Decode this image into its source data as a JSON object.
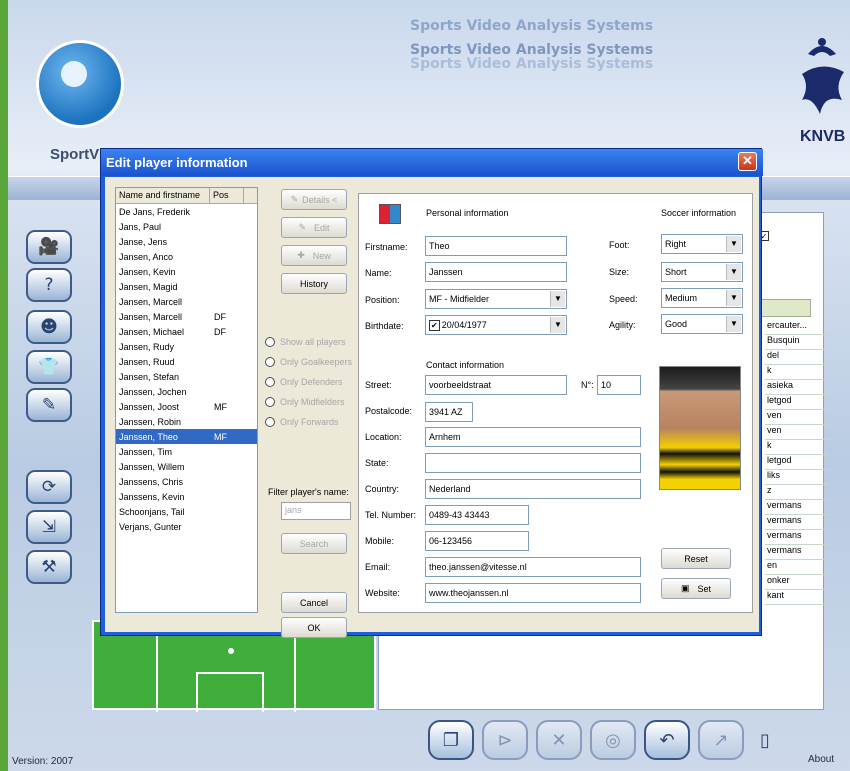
{
  "app": {
    "watermarks": [
      "Sports Video Analysis Systems",
      "Sports Video Analysis Systems",
      "Sports Video Analysis Systems"
    ],
    "brand": "SportV",
    "federation": "KNVB",
    "version": "Version: 2007",
    "about": "About",
    "right_names": [
      "ercauter...",
      "Busquin",
      "del",
      "k",
      "asieka",
      "letgod",
      "ven",
      "ven",
      "k",
      "letgod",
      "liks",
      "z",
      "vermans",
      "vermans",
      "vermans",
      "vermans",
      "en",
      "onker",
      "kant"
    ]
  },
  "dialog": {
    "title": "Edit player information",
    "close": "✕",
    "list_headers": {
      "name": "Name and firstname",
      "pos": "Pos"
    },
    "players": [
      {
        "name": "De Jans, Frederik",
        "pos": ""
      },
      {
        "name": "Jans, Paul",
        "pos": ""
      },
      {
        "name": "Janse, Jens",
        "pos": ""
      },
      {
        "name": "Jansen, Anco",
        "pos": ""
      },
      {
        "name": "Jansen, Kevin",
        "pos": ""
      },
      {
        "name": "Jansen, Magid",
        "pos": ""
      },
      {
        "name": "Jansen, Marcell",
        "pos": ""
      },
      {
        "name": "Jansen, Marcell",
        "pos": "DF"
      },
      {
        "name": "Jansen, Michael",
        "pos": "DF"
      },
      {
        "name": "Jansen, Rudy",
        "pos": ""
      },
      {
        "name": "Jansen, Ruud",
        "pos": ""
      },
      {
        "name": "Jansen, Stefan",
        "pos": ""
      },
      {
        "name": "Janssen, Jochen",
        "pos": ""
      },
      {
        "name": "Janssen, Joost",
        "pos": "MF"
      },
      {
        "name": "Janssen, Robin",
        "pos": ""
      },
      {
        "name": "Janssen, Theo",
        "pos": "MF"
      },
      {
        "name": "Janssen, Tim",
        "pos": ""
      },
      {
        "name": "Janssen, Willem",
        "pos": ""
      },
      {
        "name": "Janssens, Chris",
        "pos": ""
      },
      {
        "name": "Janssens, Kevin",
        "pos": ""
      },
      {
        "name": "Schoonjans, Tail",
        "pos": ""
      },
      {
        "name": "Verjans, Gunter",
        "pos": ""
      }
    ],
    "selected_player": "Janssen, Theo",
    "buttons": {
      "details": "Details <",
      "edit": "Edit",
      "new": "New",
      "history": "History",
      "search": "Search",
      "cancel": "Cancel",
      "ok": "OK",
      "reset": "Reset",
      "set": "Set"
    },
    "filters": [
      "Show all players",
      "Only Goalkeepers",
      "Only Defenders",
      "Only Midfielders",
      "Only Forwards"
    ],
    "filter_label": "Filter player's name:",
    "filter_value": "jans",
    "personal": {
      "heading": "Personal information",
      "firstname_label": "Firstname:",
      "firstname": "Theo",
      "name_label": "Name:",
      "name": "Janssen",
      "position_label": "Position:",
      "position": "MF - Midfielder",
      "birthdate_label": "Birthdate:",
      "birthdate": "20/04/1977",
      "birthdate_checked": "✔"
    },
    "soccer": {
      "heading": "Soccer information",
      "foot_label": "Foot:",
      "foot": "Right",
      "size_label": "Size:",
      "size": "Short",
      "speed_label": "Speed:",
      "speed": "Medium",
      "agility_label": "Agility:",
      "agility": "Good"
    },
    "contact": {
      "heading": "Contact information",
      "street_label": "Street:",
      "street": "voorbeeldstraat",
      "number_label": "N°:",
      "number": "10",
      "postalcode_label": "Postalcode:",
      "postalcode": "3941 AZ",
      "location_label": "Location:",
      "location": "Arnhem",
      "state_label": "State:",
      "state": "",
      "country_label": "Country:",
      "country": "Nederland",
      "tel_label": "Tel. Number:",
      "tel": "0489-43 43443",
      "mobile_label": "Mobile:",
      "mobile": "06-123456",
      "email_label": "Email:",
      "email": "theo.janssen@vitesse.nl",
      "website_label": "Website:",
      "website": "www.theojanssen.nl"
    }
  }
}
